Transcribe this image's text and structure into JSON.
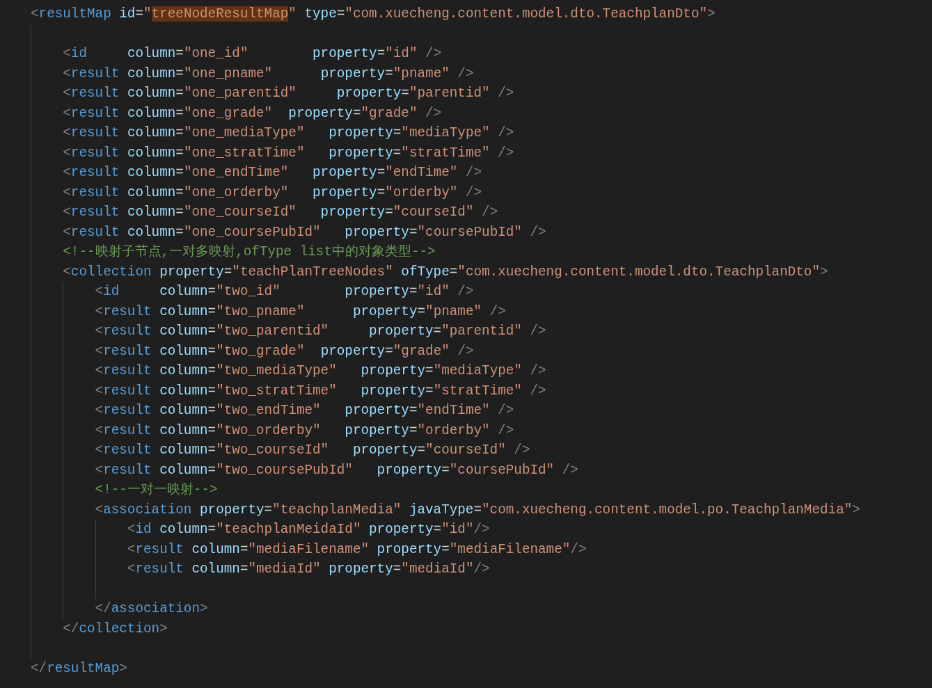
{
  "editor": {
    "lines": [
      {
        "kind": "code",
        "parts": [
          {
            "kind": "code",
            "text": "<resultMap id=\""
          },
          {
            "kind": "match",
            "text": "treeNodeResultMap"
          },
          {
            "kind": "code",
            "text": "\" type=\"com.xuecheng.content.model.dto.TeachplanDto\">"
          }
        ]
      },
      {
        "kind": "blank"
      },
      {
        "kind": "code",
        "parts": [
          {
            "kind": "code",
            "text": "    <id     column=\"one_id\"        property=\"id\" />"
          }
        ]
      },
      {
        "kind": "code",
        "parts": [
          {
            "kind": "code",
            "text": "    <result column=\"one_pname\"      property=\"pname\" />"
          }
        ]
      },
      {
        "kind": "code",
        "parts": [
          {
            "kind": "code",
            "text": "    <result column=\"one_parentid\"     property=\"parentid\" />"
          }
        ]
      },
      {
        "kind": "code",
        "parts": [
          {
            "kind": "code",
            "text": "    <result column=\"one_grade\"  property=\"grade\" />"
          }
        ]
      },
      {
        "kind": "code",
        "parts": [
          {
            "kind": "code",
            "text": "    <result column=\"one_mediaType\"   property=\"mediaType\" />"
          }
        ]
      },
      {
        "kind": "code",
        "parts": [
          {
            "kind": "code",
            "text": "    <result column=\"one_stratTime\"   property=\"stratTime\" />"
          }
        ]
      },
      {
        "kind": "code",
        "parts": [
          {
            "kind": "code",
            "text": "    <result column=\"one_endTime\"   property=\"endTime\" />"
          }
        ]
      },
      {
        "kind": "code",
        "parts": [
          {
            "kind": "code",
            "text": "    <result column=\"one_orderby\"   property=\"orderby\" />"
          }
        ]
      },
      {
        "kind": "code",
        "parts": [
          {
            "kind": "code",
            "text": "    <result column=\"one_courseId\"   property=\"courseId\" />"
          }
        ]
      },
      {
        "kind": "code",
        "parts": [
          {
            "kind": "code",
            "text": "    <result column=\"one_coursePubId\"   property=\"coursePubId\" />"
          }
        ]
      },
      {
        "kind": "code",
        "parts": [
          {
            "kind": "code",
            "text": "    <!--映射子节点,一对多映射,ofType list中的对象类型-->"
          }
        ]
      },
      {
        "kind": "code",
        "parts": [
          {
            "kind": "code",
            "text": "    <collection property=\"teachPlanTreeNodes\" ofType=\"com.xuecheng.content.model.dto.TeachplanDto\">"
          }
        ]
      },
      {
        "kind": "code",
        "parts": [
          {
            "kind": "code",
            "text": "        <id     column=\"two_id\"        property=\"id\" />"
          }
        ]
      },
      {
        "kind": "code",
        "parts": [
          {
            "kind": "code",
            "text": "        <result column=\"two_pname\"      property=\"pname\" />"
          }
        ]
      },
      {
        "kind": "code",
        "parts": [
          {
            "kind": "code",
            "text": "        <result column=\"two_parentid\"     property=\"parentid\" />"
          }
        ]
      },
      {
        "kind": "code",
        "parts": [
          {
            "kind": "code",
            "text": "        <result column=\"two_grade\"  property=\"grade\" />"
          }
        ]
      },
      {
        "kind": "code",
        "parts": [
          {
            "kind": "code",
            "text": "        <result column=\"two_mediaType\"   property=\"mediaType\" />"
          }
        ]
      },
      {
        "kind": "code",
        "parts": [
          {
            "kind": "code",
            "text": "        <result column=\"two_stratTime\"   property=\"stratTime\" />"
          }
        ]
      },
      {
        "kind": "code",
        "parts": [
          {
            "kind": "code",
            "text": "        <result column=\"two_endTime\"   property=\"endTime\" />"
          }
        ]
      },
      {
        "kind": "code",
        "parts": [
          {
            "kind": "code",
            "text": "        <result column=\"two_orderby\"   property=\"orderby\" />"
          }
        ]
      },
      {
        "kind": "code",
        "parts": [
          {
            "kind": "code",
            "text": "        <result column=\"two_courseId\"   property=\"courseId\" />"
          }
        ]
      },
      {
        "kind": "code",
        "parts": [
          {
            "kind": "code",
            "text": "        <result column=\"two_coursePubId\"   property=\"coursePubId\" />"
          }
        ]
      },
      {
        "kind": "code",
        "parts": [
          {
            "kind": "code",
            "text": "        <!--一对一映射-->"
          }
        ]
      },
      {
        "kind": "code",
        "parts": [
          {
            "kind": "code",
            "text": "        <association property=\"teachplanMedia\" javaType=\"com.xuecheng.content.model.po.TeachplanMedia\">"
          }
        ]
      },
      {
        "kind": "code",
        "parts": [
          {
            "kind": "code",
            "text": "            <id column=\"teachplanMeidaId\" property=\"id\"/>"
          }
        ]
      },
      {
        "kind": "code",
        "parts": [
          {
            "kind": "code",
            "text": "            <result column=\"mediaFilename\" property=\"mediaFilename\"/>"
          }
        ]
      },
      {
        "kind": "code",
        "parts": [
          {
            "kind": "code",
            "text": "            <result column=\"mediaId\" property=\"mediaId\"/>"
          }
        ]
      },
      {
        "kind": "blank"
      },
      {
        "kind": "code",
        "parts": [
          {
            "kind": "code",
            "text": "        </association>"
          }
        ]
      },
      {
        "kind": "code",
        "parts": [
          {
            "kind": "code",
            "text": "    </collection>"
          }
        ]
      },
      {
        "kind": "blank"
      },
      {
        "kind": "code",
        "parts": [
          {
            "kind": "code",
            "text": "</resultMap>"
          }
        ]
      }
    ]
  }
}
